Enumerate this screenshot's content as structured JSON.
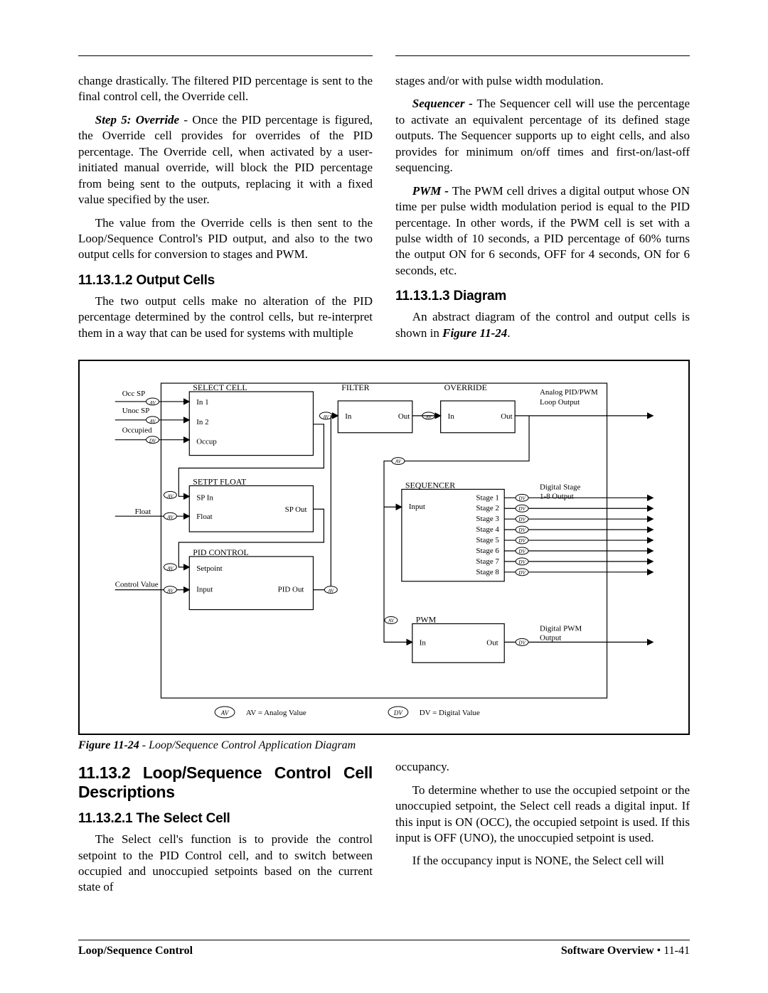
{
  "col_left": {
    "p1": "change drastically. The filtered PID percentage is sent to the final control cell, the Override cell.",
    "p2a": "Step 5: Override",
    "p2b": " - Once the PID percentage is figured, the Override cell provides for overrides of the PID percentage. The Override cell, when activated by a user-initiated manual override, will block the PID percentage from being sent to the outputs, replacing it with a fixed value specified by the user.",
    "p3": "The value from the Override cells is then sent to the Loop/Sequence Control's PID output, and also to the two output cells for conversion to stages and PWM.",
    "h3": "11.13.1.2  Output Cells",
    "p4": "The two output cells make no alteration of the PID percentage determined by the control cells, but re-interpret them in a way that can be used for systems with multiple"
  },
  "col_right": {
    "p1": "stages and/or with pulse width modulation.",
    "p2a": "Sequencer - ",
    "p2b": "The Sequencer cell will use the percentage to activate an equivalent percentage of its defined stage outputs. The Sequencer supports up to eight cells, and also provides for minimum on/off times and first-on/last-off sequencing.",
    "p3a": "PWM - ",
    "p3b": "The PWM cell drives a digital output whose ON time per pulse width modulation period is equal to the PID percentage. In other words, if the PWM cell is set with a pulse width of 10 seconds, a PID percentage of 60% turns the output ON for 6 seconds, OFF for 4 seconds, ON for 6 seconds, etc.",
    "h3": "11.13.1.3  Diagram",
    "p4a": "An abstract diagram of the control and output cells is shown in ",
    "p4b": "Figure 11-24",
    "p4c": "."
  },
  "figure": {
    "caption_bold": "Figure 11-24",
    "caption_rest": " - Loop/Sequence Control Application Diagram"
  },
  "diagram": {
    "labels": {
      "occ_sp": "Occ SP",
      "unoc_sp": "Unoc SP",
      "occupied": "Occupied",
      "select_cell": "SELECT CELL",
      "in1": "In 1",
      "in2": "In 2",
      "occup": "Occup",
      "filter": "FILTER",
      "in": "In",
      "out": "Out",
      "override": "OVERRIDE",
      "analog_out": "Analog PID/PWM",
      "analog_out2": "Loop Output",
      "setpt_float": "SETPT FLOAT",
      "sp_in": "SP In",
      "float_port": "Float",
      "float_in": "Float",
      "sp_out": "SP Out",
      "pid_control": "PID CONTROL",
      "setpoint": "Setpoint",
      "input": "Input",
      "pid_out": "PID Out",
      "control_value": "Control Value",
      "sequencer": "SEQUENCER",
      "stage": [
        "Stage 1",
        "Stage 2",
        "Stage 3",
        "Stage 4",
        "Stage 5",
        "Stage 6",
        "Stage 7",
        "Stage 8"
      ],
      "digital_stage1": "Digital Stage",
      "digital_stage2": "1-8 Output",
      "pwm": "PWM",
      "digital_pwm1": "Digital PWM",
      "digital_pwm2": "Output",
      "av_legend": "AV = Analog Value",
      "dv_legend": "DV = Digital Value",
      "av": "AV",
      "dv": "DV"
    }
  },
  "section2": {
    "h2": "11.13.2  Loop/Sequence Control Cell Descriptions",
    "h3": "11.13.2.1  The Select Cell",
    "left_p": "The Select cell's function is to provide the control setpoint to the PID Control cell, and to switch between occupied and unoccupied setpoints based on the current state of",
    "right_p1": "occupancy.",
    "right_p2": "To determine whether to use the occupied setpoint or the unoccupied setpoint, the Select cell reads a digital input. If this input is ON (OCC), the occupied setpoint is used. If this input is OFF (UNO), the unoccupied setpoint is used.",
    "right_p3": "If the occupancy input is NONE, the Select cell will"
  },
  "footer": {
    "left": "Loop/Sequence Control",
    "right_label": "Software Overview",
    "right_page": " • 11-41"
  }
}
